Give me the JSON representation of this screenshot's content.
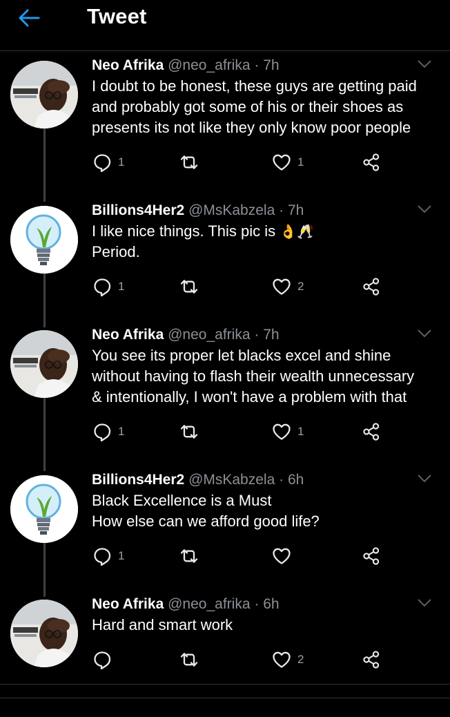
{
  "header": {
    "title": "Tweet"
  },
  "tweets": [
    {
      "name": "Neo Afrika",
      "handle": "@neo_afrika",
      "dot": "·",
      "time": "7h",
      "text": "I doubt to be honest, these guys are getting paid\nand probably got some of his or their shoes as\npresents its not like they only know poor people",
      "emoji": "",
      "text2": "",
      "reply_count": "1",
      "like_count": "1"
    },
    {
      "name": "Billions4Her2",
      "handle": "@MsKabzela",
      "dot": "·",
      "time": "7h",
      "text": "I like nice things. This pic is",
      "emoji": "👌🥂",
      "text2": "Period.",
      "reply_count": "1",
      "like_count": "2"
    },
    {
      "name": "Neo Afrika",
      "handle": "@neo_afrika",
      "dot": "·",
      "time": "7h",
      "text": "You see its proper let blacks excel and shine\nwithout having to flash their wealth unnecessary\n& intentionally, I won't have a problem with that",
      "emoji": "",
      "text2": "",
      "reply_count": "1",
      "like_count": "1"
    },
    {
      "name": "Billions4Her2",
      "handle": "@MsKabzela",
      "dot": "·",
      "time": "6h",
      "text": "Black Excellence is a Must\nHow else can we afford good life?",
      "emoji": "",
      "text2": "",
      "reply_count": "1",
      "like_count": ""
    },
    {
      "name": "Neo Afrika",
      "handle": "@neo_afrika",
      "dot": "·",
      "time": "6h",
      "text": "Hard and smart work",
      "emoji": "",
      "text2": "",
      "reply_count": "",
      "like_count": "2"
    }
  ],
  "colors": {
    "accent": "#1d9bf0",
    "background": "#000000",
    "secondary_text": "#8b9096"
  }
}
